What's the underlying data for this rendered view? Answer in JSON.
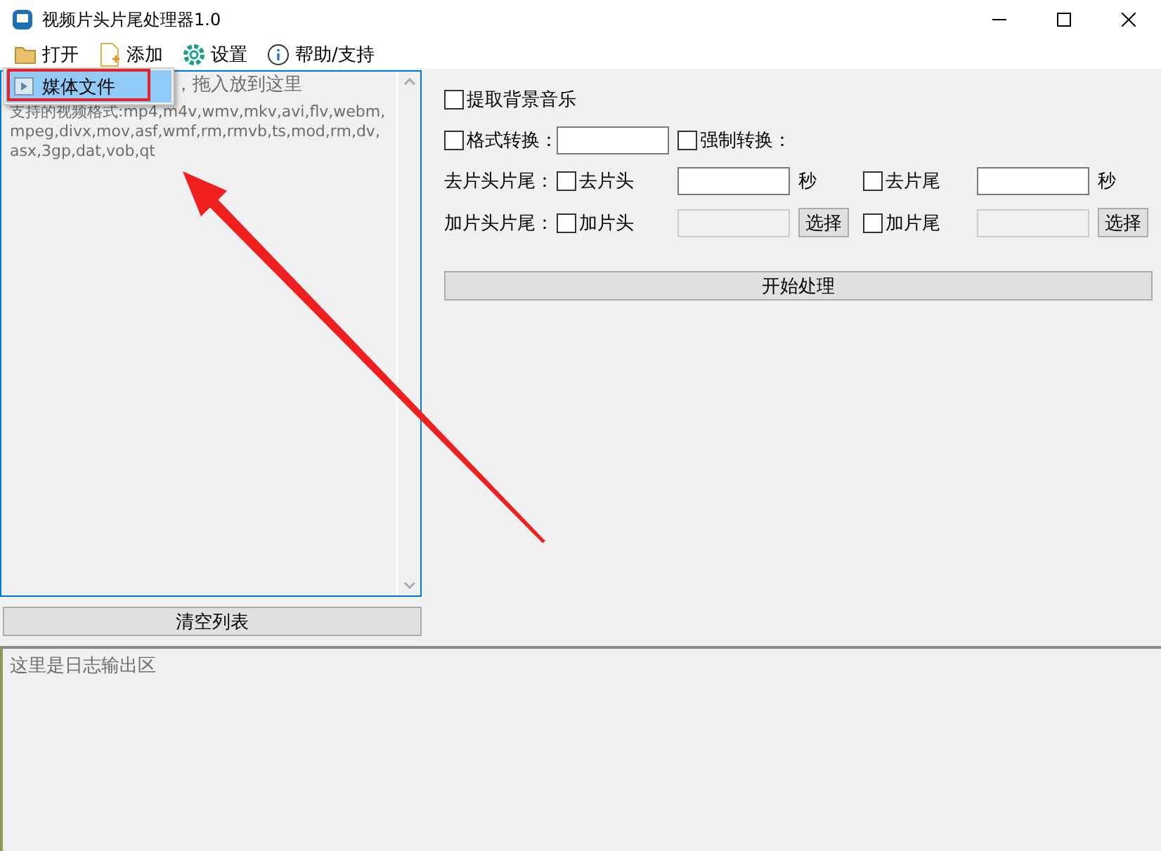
{
  "window": {
    "title": "视频片头片尾处理器1.0"
  },
  "menu_bar": [
    {
      "label": "打开"
    },
    {
      "label": "添加"
    },
    {
      "label": "设置"
    },
    {
      "label": "帮助/支持"
    }
  ],
  "dropdown": {
    "items": [
      {
        "label": "媒体文件",
        "selected": true
      }
    ]
  },
  "file_list": {
    "hint": "，拖入放到这里",
    "formats": "支持的视频格式:mp4,m4v,wmv,mkv,avi,flv,webm,mpeg,divx,mov,asf,wmf,rm,rmvb,ts,mod,rm,dv,asx,3gp,dat,vob,qt"
  },
  "clear_button": "清空列表",
  "options": [
    [
      {
        "kind": "checkbox",
        "label": "提取背景音乐",
        "checked": false
      }
    ],
    [
      {
        "kind": "checkbox",
        "label": "格式转换：",
        "checked": false
      },
      {
        "kind": "field",
        "disabled": false
      },
      {
        "kind": "checkbox",
        "label": "强制转换：",
        "checked": false
      }
    ],
    [
      {
        "kind": "label",
        "text": "去片头片尾："
      },
      {
        "kind": "checkbox",
        "label": "去片头",
        "checked": false
      },
      {
        "kind": "field",
        "disabled": false
      },
      {
        "kind": "unit",
        "text": "秒"
      },
      {
        "kind": "checkbox",
        "label": "去片尾",
        "checked": false
      },
      {
        "kind": "field",
        "disabled": false
      },
      {
        "kind": "unit",
        "text": "秒"
      }
    ],
    [
      {
        "kind": "label",
        "text": "加片头片尾："
      },
      {
        "kind": "checkbox",
        "label": "加片头",
        "checked": false
      },
      {
        "kind": "field",
        "disabled": true
      },
      {
        "kind": "button",
        "text": "选择"
      },
      {
        "kind": "checkbox",
        "label": "加片尾",
        "checked": false
      },
      {
        "kind": "field",
        "disabled": true
      },
      {
        "kind": "button",
        "text": "选择"
      }
    ]
  ],
  "start_button": "开始处理",
  "log": {
    "text": "这里是日志输出区"
  }
}
